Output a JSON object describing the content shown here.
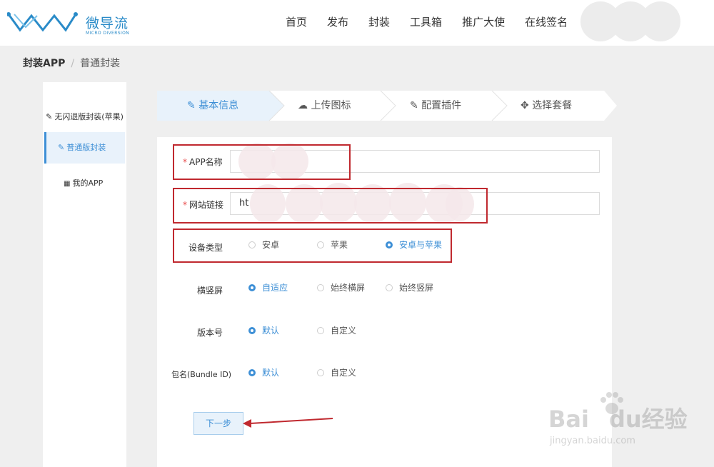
{
  "brand": {
    "name_cn": "微导流",
    "name_en": "MICRO DIVERSION"
  },
  "nav": {
    "items": [
      "首页",
      "发布",
      "封装",
      "工具箱",
      "推广大使",
      "在线签名"
    ]
  },
  "breadcrumb": {
    "current": "封装APP",
    "separator": "/",
    "sub": "普通封装"
  },
  "sidebar": {
    "items": [
      {
        "label": "无闪退版封装(苹果)",
        "icon": "edit-icon"
      },
      {
        "label": "普通版封装",
        "icon": "edit-icon",
        "active": true
      },
      {
        "label": "我的APP",
        "icon": "grid-icon"
      }
    ]
  },
  "steps": [
    {
      "label": "基本信息",
      "icon": "pencil-icon",
      "active": true
    },
    {
      "label": "上传图标",
      "icon": "cloud-upload-icon"
    },
    {
      "label": "配置插件",
      "icon": "edit-icon"
    },
    {
      "label": "选择套餐",
      "icon": "move-icon"
    }
  ],
  "form": {
    "app_name": {
      "label": "APP名称",
      "required": "*",
      "value": ""
    },
    "website": {
      "label": "网站链接",
      "required": "*",
      "value": "ht"
    },
    "device": {
      "label": "设备类型",
      "options": [
        "安卓",
        "苹果",
        "安卓与苹果"
      ],
      "selected": "安卓与苹果"
    },
    "orientation": {
      "label": "横竖屏",
      "options": [
        "自适应",
        "始终横屏",
        "始终竖屏"
      ],
      "selected": "自适应"
    },
    "version": {
      "label": "版本号",
      "options": [
        "默认",
        "自定义"
      ],
      "selected": "默认"
    },
    "bundle": {
      "label": "包名(Bundle ID)",
      "options": [
        "默认",
        "自定义"
      ],
      "selected": "默认"
    },
    "next_button": "下一步"
  },
  "watermark": {
    "brand": "Bai",
    "brand2": "du",
    "cn": "经验",
    "url": "jingyan.baidu.com"
  },
  "colors": {
    "accent": "#3d8fd6",
    "highlight": "#c0292f",
    "background": "#efefef"
  }
}
